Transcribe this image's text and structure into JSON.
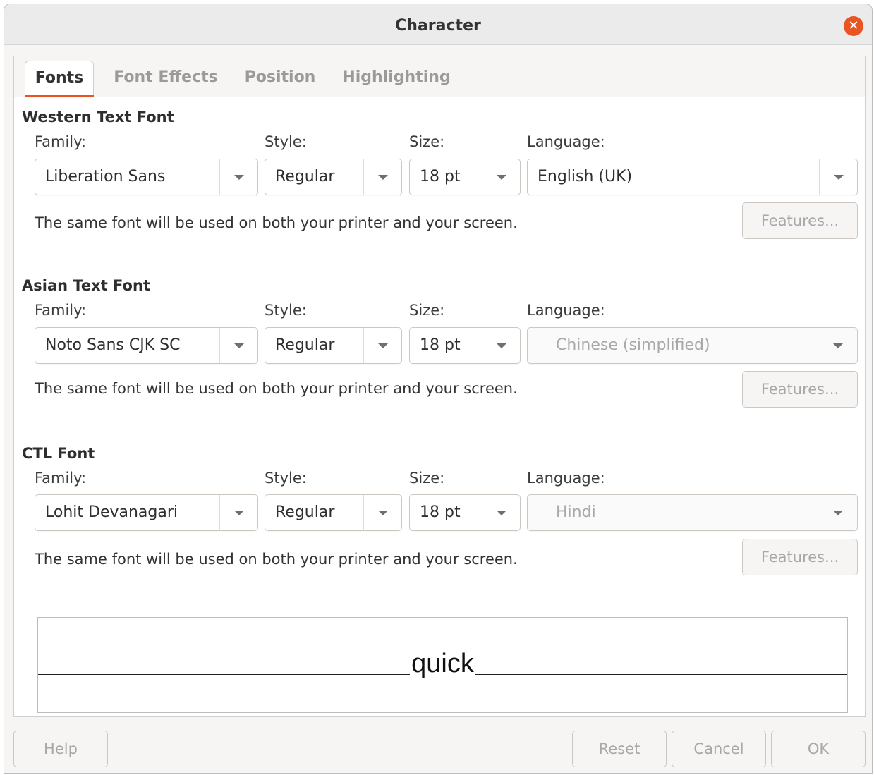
{
  "window": {
    "title": "Character"
  },
  "tabs": [
    {
      "label": "Fonts",
      "active": true
    },
    {
      "label": "Font Effects",
      "active": false
    },
    {
      "label": "Position",
      "active": false
    },
    {
      "label": "Highlighting",
      "active": false
    }
  ],
  "labels": {
    "family": "Family:",
    "style": "Style:",
    "size": "Size:",
    "language": "Language:"
  },
  "western": {
    "title": "Western Text Font",
    "family": "Liberation Sans",
    "style": "Regular",
    "size": "18 pt",
    "language": "English (UK)",
    "language_enabled": true,
    "info": "The same font will be used on both your printer and your screen.",
    "features": "Features..."
  },
  "asian": {
    "title": "Asian Text Font",
    "family": "Noto Sans CJK SC",
    "style": "Regular",
    "size": "18 pt",
    "language": "Chinese (simplified)",
    "language_enabled": false,
    "info": "The same font will be used on both your printer and your screen.",
    "features": "Features..."
  },
  "ctl": {
    "title": "CTL Font",
    "family": "Lohit Devanagari",
    "style": "Regular",
    "size": "18 pt",
    "language": "Hindi",
    "language_enabled": false,
    "info": "The same font will be used on both your printer and your screen.",
    "features": "Features..."
  },
  "preview": {
    "text": "quick"
  },
  "buttons": {
    "help": "Help",
    "reset": "Reset",
    "cancel": "Cancel",
    "ok": "OK"
  },
  "colors": {
    "accent": "#e95420"
  }
}
